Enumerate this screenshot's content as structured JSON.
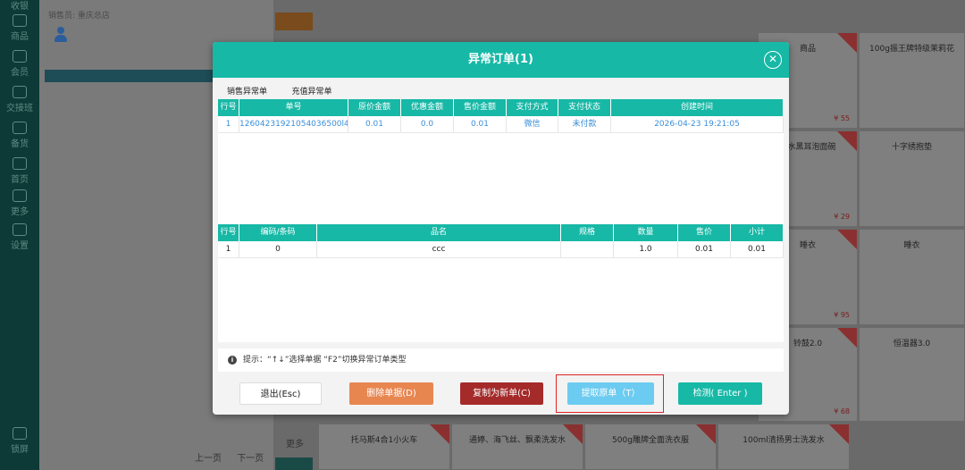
{
  "nav": {
    "items": [
      "收银",
      "商品",
      "会员",
      "交接班",
      "备货",
      "首页",
      "更多",
      "设置"
    ],
    "bottom": "锁屏"
  },
  "order_panel": {
    "top_text": "销售员: 重庆总店",
    "pager": {
      "prev": "上一页",
      "next": "下一页"
    }
  },
  "products": {
    "more_label": "更多",
    "tiles": [
      {
        "name": "商品",
        "price": "¥ 55",
        "promo": true
      },
      {
        "name": "100g振王牌特级茉莉花",
        "price": "",
        "promo": false
      },
      {
        "name": "出水黑耳泡面碗",
        "price": "¥ 29",
        "promo": true
      },
      {
        "name": "十字绣抱垫",
        "price": "",
        "promo": false
      },
      {
        "name": "睡衣",
        "price": "¥ 95",
        "promo": true
      },
      {
        "name": "睡衣",
        "price": "",
        "promo": false
      },
      {
        "name": "铃鼓2.0",
        "price": "¥ 68",
        "promo": true
      },
      {
        "name": "恒温器3.0",
        "price": "",
        "promo": false
      },
      {
        "name": "托马斯4合1小火车",
        "price": "",
        "promo": true
      },
      {
        "name": "通婷、海飞丝、飘柔洗发水",
        "price": "",
        "promo": true
      },
      {
        "name": "500g雕牌全面洗衣服",
        "price": "",
        "promo": true
      },
      {
        "name": "100ml清扬男士洗发水",
        "price": "",
        "promo": true
      }
    ]
  },
  "modal": {
    "title": "异常订单(1)",
    "close_symbol": "✕",
    "tabs": [
      {
        "label": "销售异常单",
        "active": true
      },
      {
        "label": "充值异常单",
        "active": false
      }
    ],
    "orders_table": {
      "columns": [
        "行号",
        "单号",
        "原价金额",
        "优惠金额",
        "售价金额",
        "支付方式",
        "支付状态",
        "创建时间"
      ],
      "rows": [
        [
          "1",
          "12604231921054036500l4",
          "0.01",
          "0.0",
          "0.01",
          "微信",
          "未付款",
          "2026-04-23 19:21:05"
        ]
      ]
    },
    "items_table": {
      "columns": [
        "行号",
        "编码/条码",
        "品名",
        "规格",
        "数量",
        "售价",
        "小计"
      ],
      "rows": [
        [
          "1",
          "0",
          "ccc",
          "",
          "1.0",
          "0.01",
          "0.01"
        ]
      ]
    },
    "hint": "提示：“↑↓”选择单据 “F2”切换异常订单类型",
    "hint_icon": "i",
    "buttons": {
      "exit": "退出(Esc)",
      "delete": "删除单据(D)",
      "copy": "复制为新单(C)",
      "extract": "提取原单（T）",
      "check": "检测( Enter )"
    },
    "colors": {
      "accent": "#17b8a6",
      "delete": "#e88650",
      "copy": "#a52a2a",
      "extract": "#6ccbf0",
      "highlight": "#e02424"
    }
  }
}
